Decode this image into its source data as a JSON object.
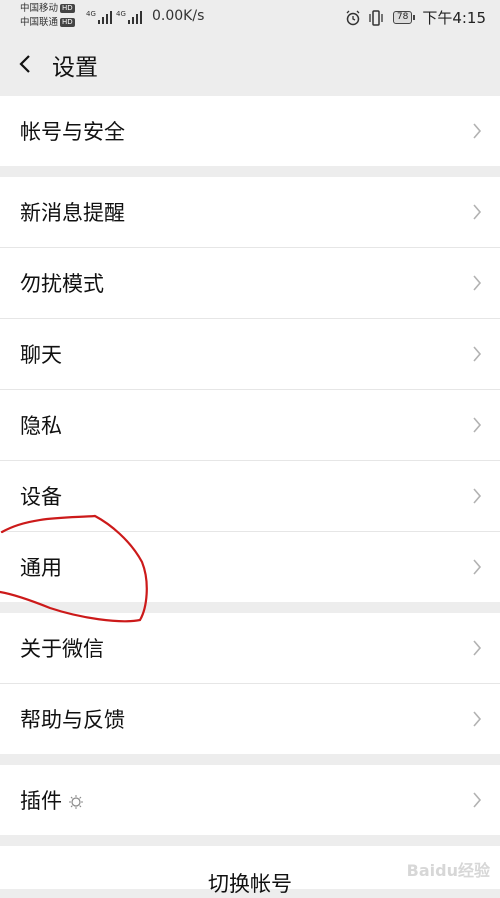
{
  "statusbar": {
    "carrier1": "中国移动",
    "carrier2": "中国联通",
    "hd1": "HD",
    "hd2": "HD",
    "speed": "0.00K/s",
    "battery": "78",
    "time": "下午4:15"
  },
  "navbar": {
    "title": "设置"
  },
  "groups": [
    {
      "items": [
        {
          "label": "帐号与安全"
        }
      ]
    },
    {
      "items": [
        {
          "label": "新消息提醒"
        },
        {
          "label": "勿扰模式"
        },
        {
          "label": "聊天"
        },
        {
          "label": "隐私"
        },
        {
          "label": "设备"
        },
        {
          "label": "通用"
        }
      ]
    },
    {
      "items": [
        {
          "label": "关于微信"
        },
        {
          "label": "帮助与反馈"
        }
      ]
    },
    {
      "items": [
        {
          "label": "插件"
        }
      ]
    }
  ],
  "bottom": {
    "switch_account": "切换帐号"
  },
  "watermark": "Baidu经验",
  "colors": {
    "background": "#ededed",
    "annotation": "#cc1a1a"
  }
}
